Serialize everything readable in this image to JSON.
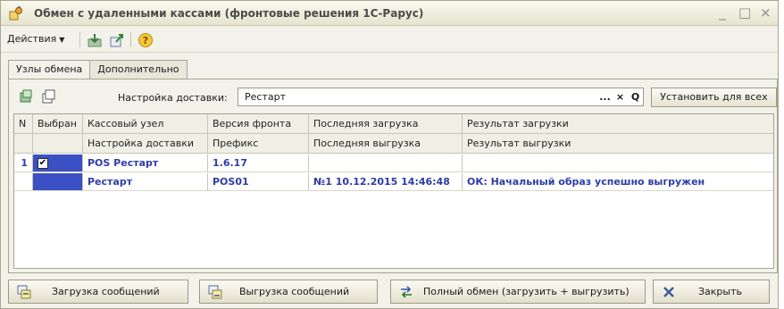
{
  "window": {
    "title": "Обмен с удаленными кассами (фронтовые решения 1С-Рарус)",
    "controls": [
      "_",
      "□",
      "×"
    ]
  },
  "toolbar": {
    "actions_label": "Действия",
    "icons": [
      "save-icon",
      "export-icon",
      "help-icon"
    ]
  },
  "tabs": [
    {
      "label": "Узлы обмена",
      "active": true
    },
    {
      "label": "Дополнительно",
      "active": false
    }
  ],
  "delivery": {
    "icons": [
      "add-node-icon",
      "copy-node-icon"
    ],
    "label": "Настройка доставки:",
    "value": "Рестарт",
    "field_buttons": [
      "...",
      "×",
      "Q"
    ],
    "set_all_label": "Установить для всех"
  },
  "grid": {
    "header_row1": [
      "N",
      "Выбран",
      "Кассовый узел",
      "Версия фронта",
      "Последняя загрузка",
      "Результат загрузки"
    ],
    "header_row2": [
      "",
      "",
      "Настройка доставки",
      "Префикс",
      "Последняя выгрузка",
      "Результат выгрузки"
    ],
    "rows": [
      {
        "n": "1",
        "selected": true,
        "node": "POS Рестарт",
        "version": "1.6.17",
        "last_load": "",
        "load_result": "",
        "delivery": "Рестарт",
        "prefix": "POS01",
        "last_unload": "№1 10.12.2015 14:46:48",
        "unload_result": "ОК: Начальный образ успешно выгружен"
      }
    ]
  },
  "footer": {
    "load_messages": "Загрузка сообщений",
    "unload_messages": "Выгрузка сообщений",
    "full_exchange": "Полный обмен (загрузить + выгрузить)",
    "close": "Закрыть"
  },
  "colors": {
    "accent_blue": "#2e3ca8",
    "selected_column": "#3a50c4",
    "window_bg": "#f2f1ea"
  }
}
